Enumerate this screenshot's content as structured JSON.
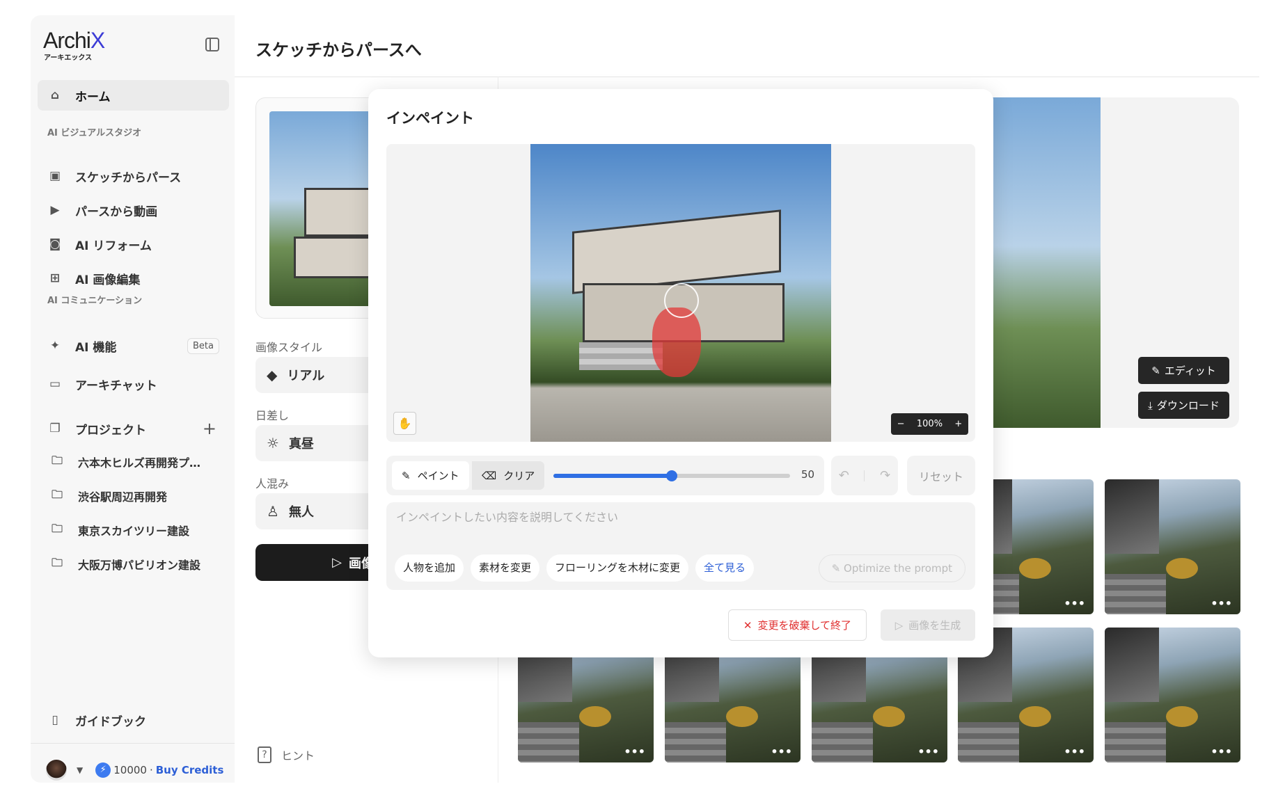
{
  "brand": {
    "name": "Archi",
    "name_accent": "X",
    "subtitle": "アーキエックス"
  },
  "sidebar": {
    "home": "ホーム",
    "section_studio": "AI ビジュアルスタジオ",
    "studio_items": [
      {
        "label": "スケッチからパース",
        "icon": "image-icon"
      },
      {
        "label": "パースから動画",
        "icon": "video-icon"
      },
      {
        "label": "AI リフォーム",
        "icon": "reform-icon"
      },
      {
        "label": "AI 画像編集",
        "icon": "image-edit-icon"
      }
    ],
    "section_comm": "AI コミュニケーション",
    "ai_features": "AI 機能",
    "beta": "Beta",
    "archichat": "アーキチャット",
    "projects_label": "プロジェクト",
    "projects": [
      "六本木ヒルズ再開発プ…",
      "渋谷駅周辺再開発",
      "東京スカイツリー建設",
      "大阪万博パビリオン建設"
    ],
    "guidebook": "ガイドブック",
    "credits": "10000",
    "credits_sep": "·",
    "buy_credits": "Buy Credits"
  },
  "header": {
    "title": "スケッチからパースへ"
  },
  "left_panel": {
    "style_label": "画像スタイル",
    "style_value": "リアル",
    "sun_label": "日差し",
    "sun_value": "真昼",
    "crowd_label": "人混み",
    "crowd_value": "無人",
    "generate": "画像",
    "hint": "ヒント"
  },
  "right_panel": {
    "edit": "エディット",
    "download": "ダウンロード",
    "thumbnail_count": 10,
    "more": "•••"
  },
  "modal": {
    "title": "インペイント",
    "zoom": "100%",
    "paint": "ペイント",
    "clear": "クリア",
    "brush_size": 50,
    "brush_max": 100,
    "reset": "リセット",
    "prompt_placeholder": "インペイントしたい内容を説明してください",
    "prompt_value": "",
    "chips": [
      "人物を追加",
      "素材を変更",
      "フローリングを木材に変更"
    ],
    "see_all": "全て見る",
    "optimize": "Optimize the prompt",
    "discard": "変更を破棄して終了",
    "generate": "画像を生成"
  },
  "colors": {
    "accent": "#2f6fe4",
    "brand_x": "#3b3bd6",
    "danger": "#e03030",
    "mask": "#e23a3a"
  }
}
